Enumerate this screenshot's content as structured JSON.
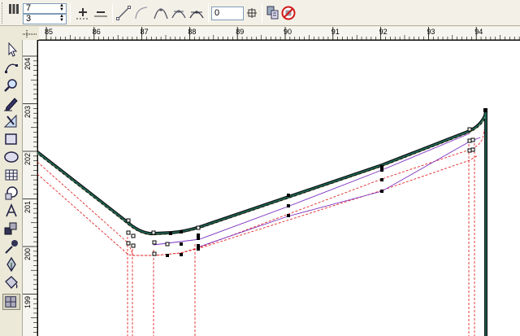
{
  "propbar": {
    "columns_value": "7",
    "rows_value": "3",
    "offset_value": "0"
  },
  "hruler": {
    "labels": [
      "85",
      "86",
      "87",
      "88",
      "89",
      "90",
      "91",
      "92",
      "93",
      "94"
    ]
  },
  "vruler": {
    "labels": [
      "204",
      "203",
      "202",
      "201",
      "200",
      "199"
    ]
  },
  "toolbox": {
    "tools": [
      "pick-tool",
      "shape-tool",
      "zoom-tool",
      "freehand-tool",
      "smart-fill-tool",
      "rectangle-tool",
      "ellipse-tool",
      "graph-paper-tool",
      "basic-shapes-tool",
      "text-tool",
      "interactive-blend-tool",
      "eyedropper-tool",
      "outline-tool",
      "fill-tool",
      "interactive-fill-tool"
    ]
  },
  "colors": {
    "main_curve": "#1d6b5a",
    "offset_red": "#e01010",
    "offset_purple": "#7a2fbf",
    "ruler_bg": "#f6f5ef",
    "ui_bg": "#ece9d8"
  }
}
